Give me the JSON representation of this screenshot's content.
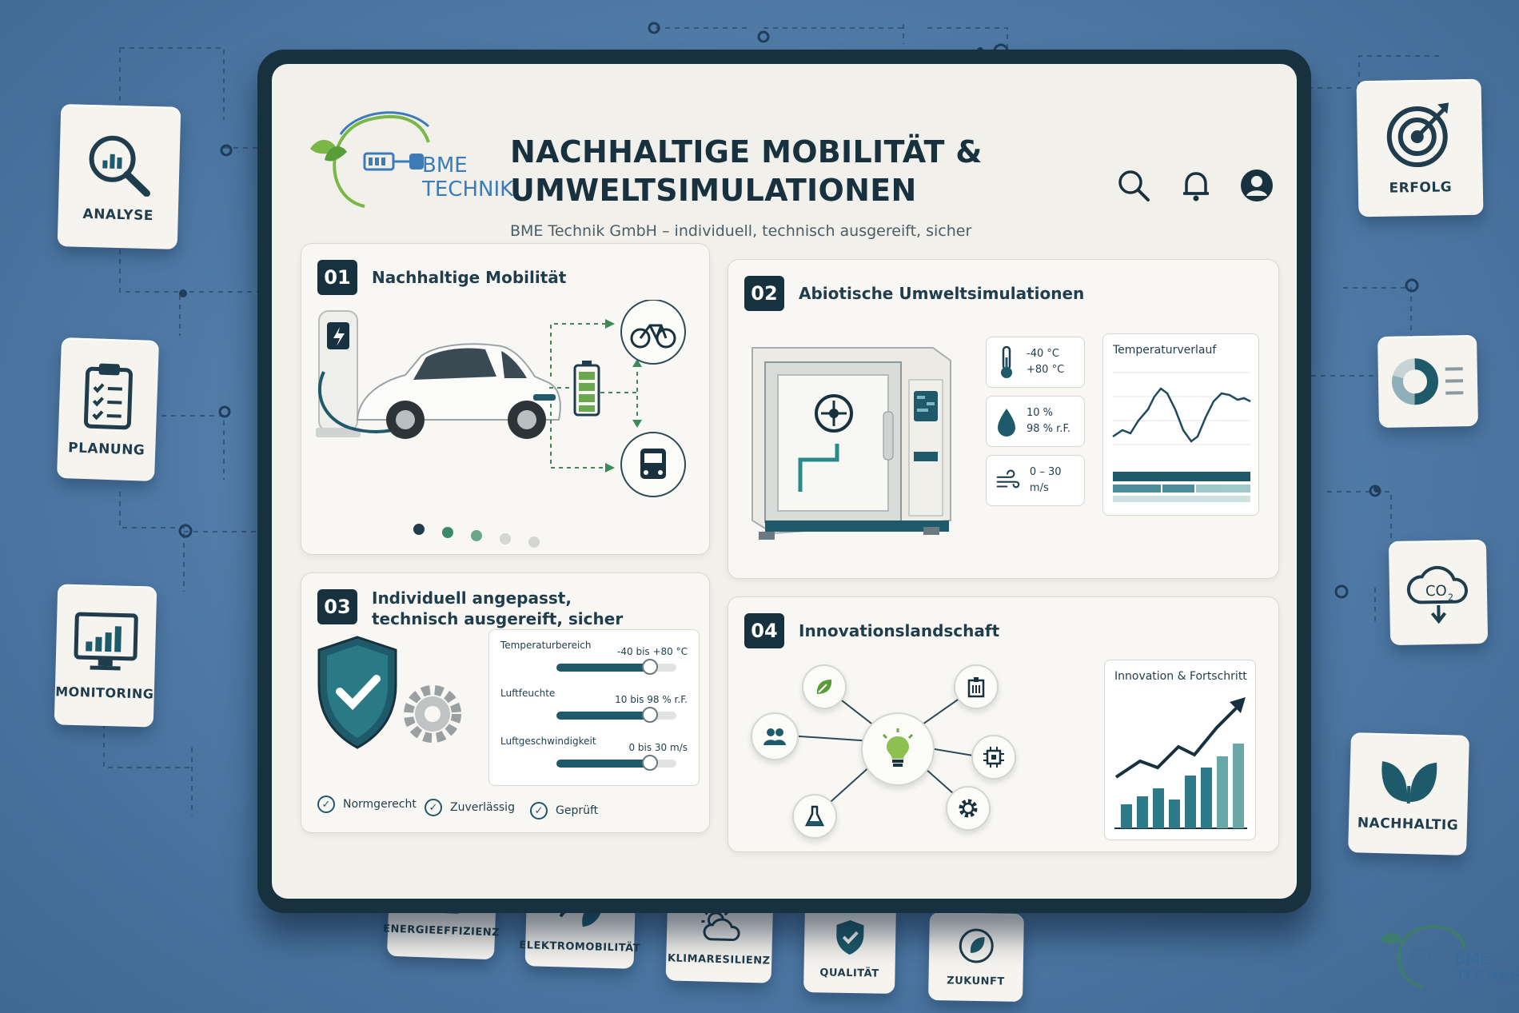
{
  "header": {
    "logo_line1": "BME",
    "logo_line2": "TECHNIK",
    "title": "Nachhaltige Mobilität & Umweltsimulationen",
    "subtitle": "BME Technik GmbH – individuell, technisch ausgereift, sicher"
  },
  "left_tiles": [
    {
      "label": "Analyse",
      "icon": "magnifier-chart-icon"
    },
    {
      "label": "Planung",
      "icon": "clipboard-checklist-icon"
    },
    {
      "label": "Monitoring",
      "icon": "monitor-chart-icon"
    }
  ],
  "right_tiles": [
    {
      "label": "Erfolg",
      "icon": "target-icon"
    },
    {
      "label": "",
      "icon": "donut-list-icon"
    },
    {
      "label": "",
      "icon": "co2-cloud-icon"
    },
    {
      "label": "Nachhaltig",
      "icon": "leaf-icon"
    }
  ],
  "bottom_tiles": [
    {
      "label": "Energieeffizienz",
      "icon": "battery-icon"
    },
    {
      "label": "Elektromobilität",
      "icon": "plug-leaf-icon"
    },
    {
      "label": "Klimaresilienz",
      "icon": "sun-cloud-icon"
    },
    {
      "label": "Qualität",
      "icon": "shield-check-icon"
    },
    {
      "label": "Zukunft",
      "icon": "leaf-circle-icon"
    }
  ],
  "panels": {
    "p1": {
      "number": "01",
      "title": "Nachhaltige Mobilität",
      "carousel": {
        "count": 5,
        "active": 0
      }
    },
    "p2": {
      "number": "02",
      "title": "Abiotische Umweltsimulationen",
      "specs": [
        {
          "line1": "-40 °C",
          "line2": "+80 °C",
          "icon": "thermometer-icon"
        },
        {
          "line1": "10 %",
          "line2": "98 % r.F.",
          "icon": "droplet-icon"
        },
        {
          "line1": "0 – 30 m/s",
          "line2": "",
          "icon": "wind-icon"
        }
      ],
      "chart_title": "Temperaturverlauf"
    },
    "p3": {
      "number": "03",
      "title": "Individuell angepasst, technisch ausgereift, sicher",
      "sliders": [
        {
          "label": "Temperaturbereich",
          "value": "-40 bis +80 °C",
          "level": 0.78
        },
        {
          "label": "Luftfeuchte",
          "value": "10 bis 98 % r.F.",
          "level": 0.78
        },
        {
          "label": "Luftgeschwindigkeit",
          "value": "0 bis 30 m/s",
          "level": 0.78
        }
      ],
      "checks": [
        "Normgerecht",
        "Zuverlässig",
        "Geprüft"
      ]
    },
    "p4": {
      "number": "04",
      "title": "Innovationslandschaft",
      "chart_title": "Innovation & Fortschritt"
    }
  },
  "colors": {
    "navy": "#17313e",
    "teal": "#1f5a6a",
    "green": "#6aa84f",
    "background_blue": "#4f7aa6"
  },
  "watermark": {
    "line1": "BME",
    "line2": "TECHNIK"
  }
}
